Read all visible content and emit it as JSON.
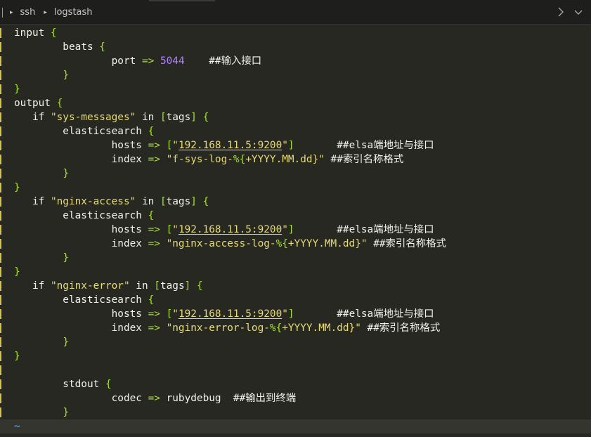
{
  "breadcrumb": [
    "ssh",
    "logstash"
  ],
  "tilde": "~",
  "lines": [
    [
      {
        "t": "input ",
        "c": "kw"
      },
      {
        "t": "{",
        "c": "brace"
      }
    ],
    [
      {
        "t": "        beats ",
        "c": "kw"
      },
      {
        "t": "{",
        "c": "brace"
      }
    ],
    [
      {
        "t": "                port ",
        "c": "kw"
      },
      {
        "t": "=>",
        "c": "op"
      },
      {
        "t": " ",
        "c": "kw"
      },
      {
        "t": "5044",
        "c": "num"
      },
      {
        "t": "    ##输入接口",
        "c": "comment"
      }
    ],
    [
      {
        "t": "        ",
        "c": "kw"
      },
      {
        "t": "}",
        "c": "brace"
      }
    ],
    [
      {
        "t": "}",
        "c": "brace"
      }
    ],
    [
      {
        "t": "output ",
        "c": "kw"
      },
      {
        "t": "{",
        "c": "brace"
      }
    ],
    [
      {
        "t": "   if ",
        "c": "kw"
      },
      {
        "t": "\"sys-messages\"",
        "c": "str"
      },
      {
        "t": " in ",
        "c": "kw"
      },
      {
        "t": "[",
        "c": "brace"
      },
      {
        "t": "tags",
        "c": "kw"
      },
      {
        "t": "]",
        "c": "brace"
      },
      {
        "t": " ",
        "c": "kw"
      },
      {
        "t": "{",
        "c": "brace"
      }
    ],
    [
      {
        "t": "        elasticsearch ",
        "c": "kw"
      },
      {
        "t": "{",
        "c": "brace"
      }
    ],
    [
      {
        "t": "                hosts ",
        "c": "kw"
      },
      {
        "t": "=>",
        "c": "op"
      },
      {
        "t": " ",
        "c": "kw"
      },
      {
        "t": "[",
        "c": "brace"
      },
      {
        "t": "\"",
        "c": "str"
      },
      {
        "t": "192.168.11.5:9200",
        "c": "str ul"
      },
      {
        "t": "\"",
        "c": "str"
      },
      {
        "t": "]",
        "c": "brace"
      },
      {
        "t": "       ##elsa端地址与接口",
        "c": "comment"
      }
    ],
    [
      {
        "t": "                index ",
        "c": "kw"
      },
      {
        "t": "=>",
        "c": "op"
      },
      {
        "t": " ",
        "c": "kw"
      },
      {
        "t": "\"f-sys-log-",
        "c": "str"
      },
      {
        "t": "%{",
        "c": "op"
      },
      {
        "t": "+YYYY.MM.dd",
        "c": "str"
      },
      {
        "t": "}\"",
        "c": "str"
      },
      {
        "t": " ##索引名称格式",
        "c": "comment"
      }
    ],
    [
      {
        "t": "        ",
        "c": "kw"
      },
      {
        "t": "}",
        "c": "brace"
      }
    ],
    [
      {
        "t": "}",
        "c": "brace"
      }
    ],
    [
      {
        "t": "   if ",
        "c": "kw"
      },
      {
        "t": "\"nginx-access\"",
        "c": "str"
      },
      {
        "t": " in ",
        "c": "kw"
      },
      {
        "t": "[",
        "c": "brace"
      },
      {
        "t": "tags",
        "c": "kw"
      },
      {
        "t": "]",
        "c": "brace"
      },
      {
        "t": " ",
        "c": "kw"
      },
      {
        "t": "{",
        "c": "brace"
      }
    ],
    [
      {
        "t": "        elasticsearch ",
        "c": "kw"
      },
      {
        "t": "{",
        "c": "brace"
      }
    ],
    [
      {
        "t": "                hosts ",
        "c": "kw"
      },
      {
        "t": "=>",
        "c": "op"
      },
      {
        "t": " ",
        "c": "kw"
      },
      {
        "t": "[",
        "c": "brace"
      },
      {
        "t": "\"",
        "c": "str"
      },
      {
        "t": "192.168.11.5:9200",
        "c": "str ul"
      },
      {
        "t": "\"",
        "c": "str"
      },
      {
        "t": "]",
        "c": "brace"
      },
      {
        "t": "       ##elsa端地址与接口",
        "c": "comment"
      }
    ],
    [
      {
        "t": "                index ",
        "c": "kw"
      },
      {
        "t": "=>",
        "c": "op"
      },
      {
        "t": " ",
        "c": "kw"
      },
      {
        "t": "\"nginx-access-log-",
        "c": "str"
      },
      {
        "t": "%{",
        "c": "op"
      },
      {
        "t": "+YYYY.MM.dd",
        "c": "str"
      },
      {
        "t": "}\"",
        "c": "str"
      },
      {
        "t": " ##索引名称格式",
        "c": "comment"
      }
    ],
    [
      {
        "t": "        ",
        "c": "kw"
      },
      {
        "t": "}",
        "c": "brace"
      }
    ],
    [
      {
        "t": "}",
        "c": "brace"
      }
    ],
    [
      {
        "t": "   if ",
        "c": "kw"
      },
      {
        "t": "\"nginx-error\"",
        "c": "str"
      },
      {
        "t": " in ",
        "c": "kw"
      },
      {
        "t": "[",
        "c": "brace"
      },
      {
        "t": "tags",
        "c": "kw"
      },
      {
        "t": "]",
        "c": "brace"
      },
      {
        "t": " ",
        "c": "kw"
      },
      {
        "t": "{",
        "c": "brace"
      }
    ],
    [
      {
        "t": "        elasticsearch ",
        "c": "kw"
      },
      {
        "t": "{",
        "c": "brace"
      }
    ],
    [
      {
        "t": "                hosts ",
        "c": "kw"
      },
      {
        "t": "=>",
        "c": "op"
      },
      {
        "t": " ",
        "c": "kw"
      },
      {
        "t": "[",
        "c": "brace"
      },
      {
        "t": "\"",
        "c": "str"
      },
      {
        "t": "192.168.11.5:9200",
        "c": "str ul"
      },
      {
        "t": "\"",
        "c": "str"
      },
      {
        "t": "]",
        "c": "brace"
      },
      {
        "t": "       ##elsa端地址与接口",
        "c": "comment"
      }
    ],
    [
      {
        "t": "                index ",
        "c": "kw"
      },
      {
        "t": "=>",
        "c": "op"
      },
      {
        "t": " ",
        "c": "kw"
      },
      {
        "t": "\"nginx-error-log-",
        "c": "str"
      },
      {
        "t": "%{",
        "c": "op"
      },
      {
        "t": "+YYYY.MM.dd",
        "c": "str"
      },
      {
        "t": "}\"",
        "c": "str"
      },
      {
        "t": " ##索引名称格式",
        "c": "comment"
      }
    ],
    [
      {
        "t": "        ",
        "c": "kw"
      },
      {
        "t": "}",
        "c": "brace"
      }
    ],
    [
      {
        "t": "}",
        "c": "brace"
      }
    ],
    [
      {
        "t": "",
        "c": "kw"
      }
    ],
    [
      {
        "t": "        stdout ",
        "c": "kw"
      },
      {
        "t": "{",
        "c": "brace"
      }
    ],
    [
      {
        "t": "                codec ",
        "c": "kw"
      },
      {
        "t": "=>",
        "c": "op"
      },
      {
        "t": " rubydebug  ##输出到终端",
        "c": "kw"
      }
    ],
    [
      {
        "t": "        ",
        "c": "kw"
      },
      {
        "t": "}",
        "c": "brace"
      }
    ],
    [
      {
        "t": "}",
        "c": "brace"
      }
    ]
  ],
  "colors": {
    "background": "#272822",
    "text": "#f2f2ec",
    "brace": "#a6e22e",
    "string": "#e6db74",
    "number": "#ae81ff",
    "tilde": "#75b7e6",
    "gutter_marker": "#d7c24a"
  },
  "icons": {
    "titlebar_right": [
      "chevron-right-icon",
      "chevron-down-icon"
    ]
  }
}
